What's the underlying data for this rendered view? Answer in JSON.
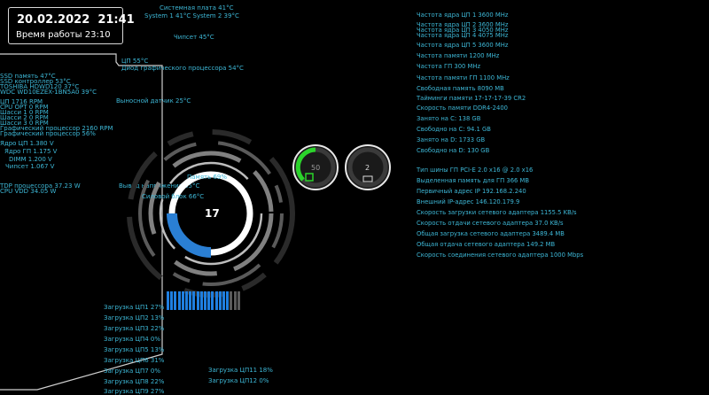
{
  "datetime": {
    "date": "20.02.2022",
    "time": "21:41",
    "uptime": "Время работы 23:10"
  },
  "top_temps": {
    "system_board": "Системная плата 41°C",
    "system12": "System 1 41°C  System 2 39°C",
    "chipset": "Чипсет 45°C",
    "cpu_temp": "ЦП 55°C",
    "gpu_temp": "Диод графического процессора 54°C",
    "remote_sensor": "Выносной датчик 25°C",
    "vrm_out": "Вывод напряжения 55°C"
  },
  "left_stats": [
    "SSD память 47°C",
    "SSD контроллер 53°C",
    "TOSHIBA HDWD120 37°C",
    "WDC WD10EZEX-1BN5A0 39°C",
    "ЦП 1716 RPM",
    "CPU OPT 0 RPM",
    "Шасси 1 0 RPM",
    "Шасси 2 0 RPM",
    "Шасси 3 0 RPM",
    "Графический процессор 2160 RPM",
    "Графический процессор 56%",
    "Ядро ЦП 1.380 V",
    "Ядро ГП 1.175 V",
    "DIMM 1.200 V",
    "Чипсет 1.067 V",
    "TDP процессора 37.23 W",
    "CPU VDD 34.05 W"
  ],
  "center": {
    "memory": "Память 69%",
    "power_block": "Силовой блок 66°C",
    "ring_value": "17",
    "gauge1_value": "50",
    "gauge2_value": "2"
  },
  "cpu_loads_col1": [
    "Загрузка ЦП1 27%",
    "Загрузка ЦП2 13%",
    "Загрузка ЦП3 22%",
    "Загрузка ЦП4 0%",
    "Загрузка ЦП5 13%",
    "Загрузка ЦП6 31%",
    "Загрузка ЦП7 0%",
    "Загрузка ЦП8 22%",
    "Загрузка ЦП9 27%"
  ],
  "cpu_loads_col2": [
    "Загрузка ЦП11 18%",
    "Загрузка ЦП12 0%"
  ],
  "right_stats": [
    "Частота ядра ЦП 1 3600 MHz",
    "Частота ядра ЦП 2 3600 MHz",
    "Частота ядра ЦП 3 4050 MHz",
    "Частота ядра ЦП 4 4075 MHz",
    "Частота ядра ЦП 5 3600 MHz",
    "Частота памяти 1200 MHz",
    "Частота ГП 300 MHz",
    "Частота памяти ГП 1100 MHz",
    "Свободная память 8090 MB",
    "Тайминги памяти 17-17-17-39 CR2",
    "Скорость памяти DDR4-2400",
    "Занято на C: 138 GB",
    "Свободно на C: 94.1 GB",
    "Занято на D: 1733 GB",
    "Свободно на D: 130 GB"
  ],
  "right_stats2": [
    "Тип шины ГП PCI-E 2.0 x16 @ 2.0 x16",
    "Выделенная память для ГП 366 MB",
    "Первичный адрес IP 192.168.2.240",
    "Внешний IP-адрес 146.120.179.9",
    "Скорость загрузки сетевого адаптера 1155.5 KB/s",
    "Скорость отдачи сетевого адаптера 37.0 KB/s",
    "Общая загрузка сетевого адаптера 3489.4 MB",
    "Общая отдача сетевого адаптера 149.2 MB",
    "Скорость соединения сетевого адаптера 1000 Mbps"
  ],
  "colors": {
    "accent": "#3db7d6",
    "ring_blue": "#2a7fd4",
    "gauge_green": "#2bd42b",
    "bar_blue": "#1f7fe0"
  },
  "load_bar_levels": [
    1,
    1,
    1,
    1,
    1,
    1,
    1,
    1,
    1,
    1,
    1,
    1,
    1,
    1,
    1,
    1,
    1,
    0,
    0,
    0
  ]
}
